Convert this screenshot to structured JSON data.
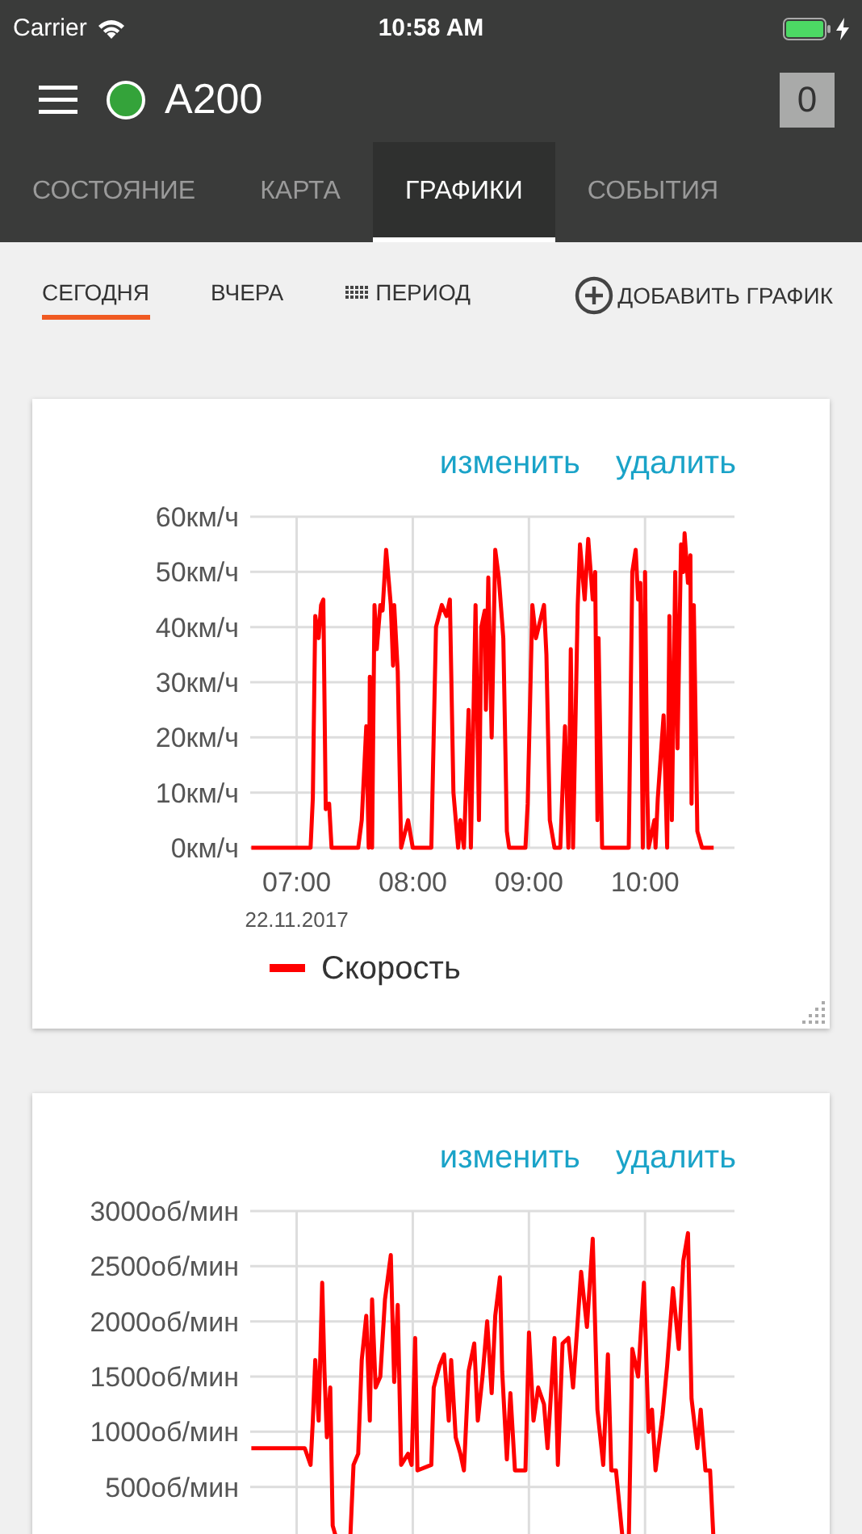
{
  "status_bar": {
    "carrier": "Carrier",
    "time": "10:58 AM"
  },
  "header": {
    "vehicle": "A200",
    "online": true,
    "badge": "0"
  },
  "tabs": [
    {
      "label": "СОСТОЯНИЕ",
      "selected": false
    },
    {
      "label": "КАРТА",
      "selected": false
    },
    {
      "label": "ГРАФИКИ",
      "selected": true
    },
    {
      "label": "СОБЫТИЯ",
      "selected": false
    }
  ],
  "filters": [
    {
      "label": "СЕГОДНЯ",
      "kind": "text",
      "selected": true
    },
    {
      "label": "ВЧЕРА",
      "kind": "text",
      "selected": false
    },
    {
      "label": "ПЕРИОД",
      "kind": "period",
      "selected": false
    }
  ],
  "add_chart": {
    "label": "ДОБАВИТЬ ГРАФИК"
  },
  "cards": [
    {
      "edit": "изменить",
      "delete": "удалить",
      "date_label": "22.11.2017",
      "resizable": true,
      "chart_data": {
        "type": "line",
        "grid": true,
        "xlim": [
          6.6,
          10.77
        ],
        "ylim": [
          0,
          60
        ],
        "xticks": [
          {
            "value": 7,
            "label": "07:00"
          },
          {
            "value": 8,
            "label": "08:00"
          },
          {
            "value": 9,
            "label": "09:00"
          },
          {
            "value": 10,
            "label": "10:00"
          }
        ],
        "yticks": [
          {
            "value": 0,
            "label": "0км/ч"
          },
          {
            "value": 10,
            "label": "10км/ч"
          },
          {
            "value": 20,
            "label": "20км/ч"
          },
          {
            "value": 30,
            "label": "30км/ч"
          },
          {
            "value": 40,
            "label": "40км/ч"
          },
          {
            "value": 50,
            "label": "50км/ч"
          },
          {
            "value": 60,
            "label": "60км/ч"
          }
        ],
        "x": [
          6.61,
          7.12,
          7.14,
          7.16,
          7.19,
          7.21,
          7.23,
          7.25,
          7.28,
          7.3,
          7.53,
          7.56,
          7.6,
          7.62,
          7.63,
          7.65,
          7.67,
          7.69,
          7.72,
          7.74,
          7.77,
          7.81,
          7.83,
          7.84,
          7.87,
          7.9,
          7.96,
          8.0,
          8.16,
          8.2,
          8.25,
          8.29,
          8.32,
          8.35,
          8.39,
          8.41,
          8.44,
          8.48,
          8.5,
          8.54,
          8.57,
          8.59,
          8.62,
          8.63,
          8.65,
          8.68,
          8.71,
          8.74,
          8.78,
          8.81,
          8.83,
          8.97,
          8.99,
          9.03,
          9.06,
          9.13,
          9.15,
          9.18,
          9.22,
          9.27,
          9.31,
          9.34,
          9.36,
          9.38,
          9.42,
          9.44,
          9.48,
          9.51,
          9.55,
          9.57,
          9.59,
          9.6,
          9.63,
          9.86,
          9.89,
          9.92,
          9.94,
          9.96,
          9.98,
          10.0,
          10.02,
          10.03,
          10.08,
          10.09,
          10.11,
          10.16,
          10.19,
          10.21,
          10.23,
          10.26,
          10.28,
          10.31,
          10.33,
          10.34,
          10.37,
          10.39,
          10.4,
          10.42,
          10.45,
          10.49,
          10.59
        ],
        "series": [
          {
            "name": "Скорость",
            "color": "#ff0000",
            "values": [
              0,
              0,
              9,
              42,
              38,
              44,
              45,
              7,
              8,
              0,
              0,
              5,
              22,
              0,
              31,
              0,
              44,
              36,
              44,
              43,
              54,
              44,
              33,
              44,
              32,
              0,
              5,
              0,
              0,
              40,
              44,
              42,
              45,
              10,
              0,
              5,
              0,
              25,
              0,
              44,
              5,
              40,
              43,
              25,
              49,
              20,
              54,
              49,
              38,
              3,
              0,
              0,
              8,
              44,
              38,
              44,
              35,
              5,
              0,
              0,
              22,
              0,
              36,
              0,
              44,
              55,
              45,
              56,
              45,
              50,
              5,
              38,
              0,
              0,
              50,
              54,
              45,
              48,
              0,
              50,
              10,
              0,
              5,
              0,
              9,
              24,
              0,
              42,
              5,
              50,
              18,
              55,
              50,
              57,
              48,
              53,
              8,
              44,
              3,
              0,
              0
            ]
          }
        ]
      }
    },
    {
      "edit": "изменить",
      "delete": "удалить",
      "chart_data": {
        "type": "line",
        "grid": true,
        "xlim": [
          6.6,
          10.77
        ],
        "ylim": [
          0,
          3000
        ],
        "yticks": [
          {
            "value": 500,
            "label": "500об/мин"
          },
          {
            "value": 1000,
            "label": "1000об/мин"
          },
          {
            "value": 1500,
            "label": "1500об/мин"
          },
          {
            "value": 2000,
            "label": "2000об/мин"
          },
          {
            "value": 2500,
            "label": "2500об/мин"
          },
          {
            "value": 3000,
            "label": "3000об/мин"
          }
        ],
        "x": [
          6.61,
          7.07,
          7.12,
          7.14,
          7.16,
          7.19,
          7.22,
          7.24,
          7.26,
          7.29,
          7.31,
          7.35,
          7.46,
          7.49,
          7.53,
          7.56,
          7.6,
          7.63,
          7.65,
          7.68,
          7.72,
          7.76,
          7.81,
          7.84,
          7.87,
          7.9,
          7.96,
          7.99,
          8.02,
          8.04,
          8.16,
          8.18,
          8.23,
          8.27,
          8.31,
          8.33,
          8.37,
          8.41,
          8.44,
          8.48,
          8.53,
          8.56,
          8.6,
          8.64,
          8.68,
          8.71,
          8.75,
          8.77,
          8.81,
          8.84,
          8.88,
          8.97,
          9.0,
          9.04,
          9.08,
          9.13,
          9.16,
          9.22,
          9.25,
          9.29,
          9.34,
          9.38,
          9.45,
          9.5,
          9.55,
          9.59,
          9.64,
          9.68,
          9.71,
          9.75,
          9.81,
          9.86,
          9.89,
          9.94,
          9.99,
          10.03,
          10.06,
          10.09,
          10.15,
          10.19,
          10.24,
          10.29,
          10.33,
          10.37,
          10.4,
          10.45,
          10.48,
          10.52,
          10.56,
          10.59
        ],
        "series": [
          {
            "color": "#ff0000",
            "values": [
              850,
              850,
              700,
              1100,
              1650,
              1100,
              2350,
              1550,
              950,
              1400,
              150,
              0,
              0,
              700,
              800,
              1650,
              2050,
              1100,
              2200,
              1400,
              1500,
              2200,
              2600,
              1450,
              2150,
              700,
              800,
              700,
              1850,
              650,
              700,
              1400,
              1600,
              1700,
              1100,
              1650,
              950,
              800,
              650,
              1550,
              1800,
              1100,
              1500,
              2000,
              1350,
              2050,
              2400,
              1550,
              750,
              1350,
              650,
              650,
              1900,
              1100,
              1400,
              1250,
              850,
              1850,
              700,
              1800,
              1850,
              1400,
              2450,
              1950,
              2750,
              1200,
              700,
              1700,
              650,
              650,
              0,
              0,
              1750,
              1500,
              2350,
              1000,
              1200,
              650,
              1150,
              1600,
              2300,
              1750,
              2550,
              2800,
              1300,
              850,
              1200,
              650,
              650,
              0
            ]
          }
        ]
      }
    }
  ]
}
